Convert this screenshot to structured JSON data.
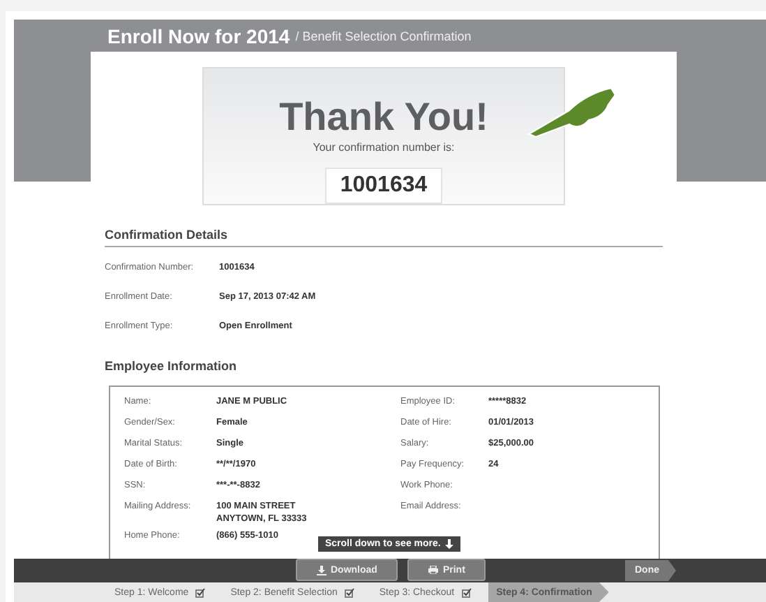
{
  "header": {
    "title": "Enroll Now for 2014",
    "subtitle": "/ Benefit Selection Confirmation"
  },
  "thank_you": {
    "heading": "Thank You!",
    "message": "Your confirmation number is:",
    "number": "1001634"
  },
  "confirmation_details": {
    "heading": "Confirmation Details",
    "rows": [
      {
        "label": "Confirmation Number:",
        "value": "1001634"
      },
      {
        "label": "Enrollment Date:",
        "value": "Sep 17, 2013 07:42 AM"
      },
      {
        "label": "Enrollment Type:",
        "value": "Open Enrollment"
      }
    ]
  },
  "employee_information": {
    "heading": "Employee Information",
    "rows": [
      {
        "label": "Name:",
        "value": "JANE M PUBLIC",
        "label_2": "Employee ID:",
        "value_2": "*****8832"
      },
      {
        "label": "Gender/Sex:",
        "value": "Female",
        "label_2": "Date of Hire:",
        "value_2": "01/01/2013"
      },
      {
        "label": "Marital Status:",
        "value": "Single",
        "label_2": "Salary:",
        "value_2": "$25,000.00"
      },
      {
        "label": "Date of Birth:",
        "value": "**/**/1970",
        "label_2": "Pay Frequency:",
        "value_2": "24"
      },
      {
        "label": "SSN:",
        "value": "***-**-8832",
        "label_2": "Work Phone:"
      },
      {
        "label": "Mailing Address:",
        "value": "100 MAIN STREET",
        "value_line_2": "ANYTOWN, FL 33333",
        "label_2": "Email Address:"
      },
      {
        "label": "Home Phone:",
        "value": "(866) 555-1010"
      }
    ]
  },
  "scroll_hint": "Scroll down to see more.",
  "actions": [
    {
      "kind": "download",
      "label": "Download"
    },
    {
      "kind": "print",
      "label": "Print"
    }
  ],
  "done_button": "Done",
  "steps": [
    {
      "label": "Step 1: Welcome",
      "checked": true,
      "selected": false
    },
    {
      "label": "Step 2: Benefit Selection",
      "checked": true,
      "selected": false
    },
    {
      "label": "Step 3: Checkout",
      "checked": true,
      "selected": false
    },
    {
      "label": "Step 4: Confirmation",
      "checked": false,
      "selected": true
    }
  ]
}
